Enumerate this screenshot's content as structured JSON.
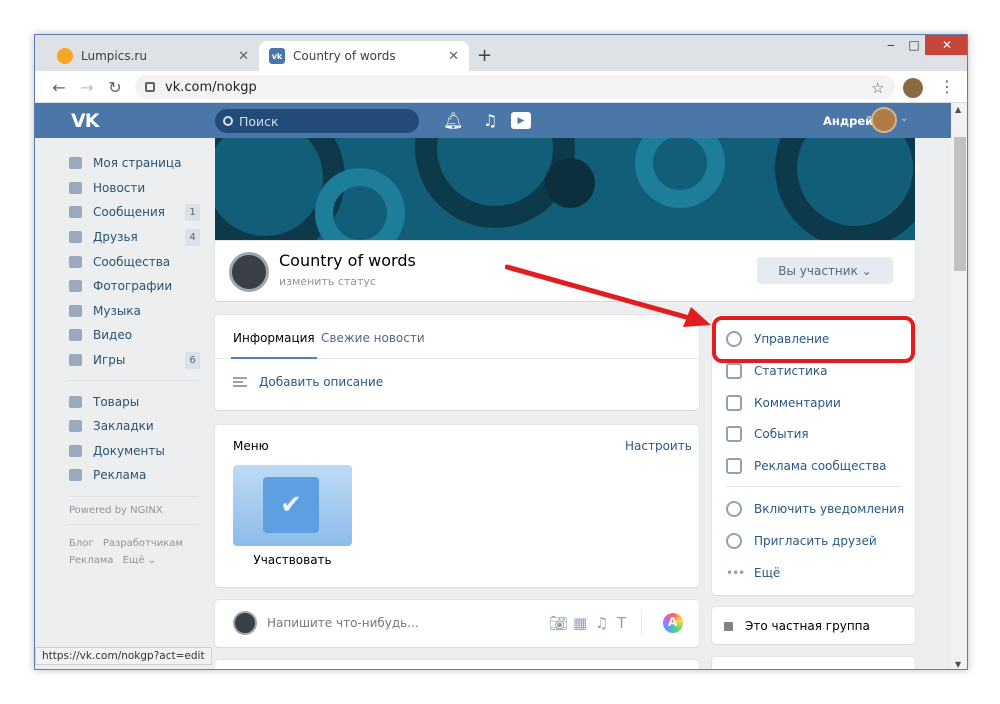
{
  "browser": {
    "tabs": [
      {
        "title": "Lumpics.ru",
        "favicon": "lumpics-favicon",
        "active": false
      },
      {
        "title": "Country of words",
        "favicon": "vk-favicon",
        "active": true
      }
    ],
    "new_tab": "+",
    "window_controls": {
      "minimize": "‒",
      "maximize": "□",
      "close": "✕"
    },
    "url": "vk.com/nokgp",
    "status_url": "https://vk.com/nokgp?act=edit"
  },
  "vk_header": {
    "logo": "VK",
    "search_placeholder": "Поиск",
    "user_name": "Андрей"
  },
  "left_nav": {
    "items": [
      {
        "label": "Моя страница",
        "badge": null
      },
      {
        "label": "Новости",
        "badge": null
      },
      {
        "label": "Сообщения",
        "badge": "1"
      },
      {
        "label": "Друзья",
        "badge": "4"
      },
      {
        "label": "Сообщества",
        "badge": null
      },
      {
        "label": "Фотографии",
        "badge": null
      },
      {
        "label": "Музыка",
        "badge": null
      },
      {
        "label": "Видео",
        "badge": null
      },
      {
        "label": "Игры",
        "badge": "6"
      }
    ],
    "items2": [
      {
        "label": "Товары"
      },
      {
        "label": "Закладки"
      },
      {
        "label": "Документы"
      },
      {
        "label": "Реклама"
      }
    ],
    "powered": "Powered by NGINX",
    "footer": [
      "Блог",
      "Разработчикам",
      "Реклама",
      "Ещё ⌄"
    ]
  },
  "group": {
    "name": "Country of words",
    "status": "изменить статус",
    "member_button": "Вы участник ⌄"
  },
  "info": {
    "tabs": [
      "Информация",
      "Свежие новости"
    ],
    "add_description": "Добавить описание"
  },
  "menu": {
    "title": "Меню",
    "setup": "Настроить",
    "item_caption": "Участвовать"
  },
  "post": {
    "placeholder": "Напишите что-нибудь..."
  },
  "actions": {
    "items": [
      {
        "label": "Управление",
        "icon": "gear-icon"
      },
      {
        "label": "Статистика",
        "icon": "stats-icon"
      },
      {
        "label": "Комментарии",
        "icon": "comment-icon"
      },
      {
        "label": "События",
        "icon": "calendar-icon"
      },
      {
        "label": "Реклама сообщества",
        "icon": "megaphone-icon"
      },
      {
        "label": "Включить уведомления",
        "icon": "bell-icon"
      },
      {
        "label": "Пригласить друзей",
        "icon": "add-user-icon"
      },
      {
        "label": "Ещё",
        "icon": "more-icon"
      }
    ],
    "private_group": "Это частная группа"
  },
  "colors": {
    "vk_blue": "#4a76a8",
    "highlight_red": "#e11d1d",
    "link": "#2a5885"
  }
}
